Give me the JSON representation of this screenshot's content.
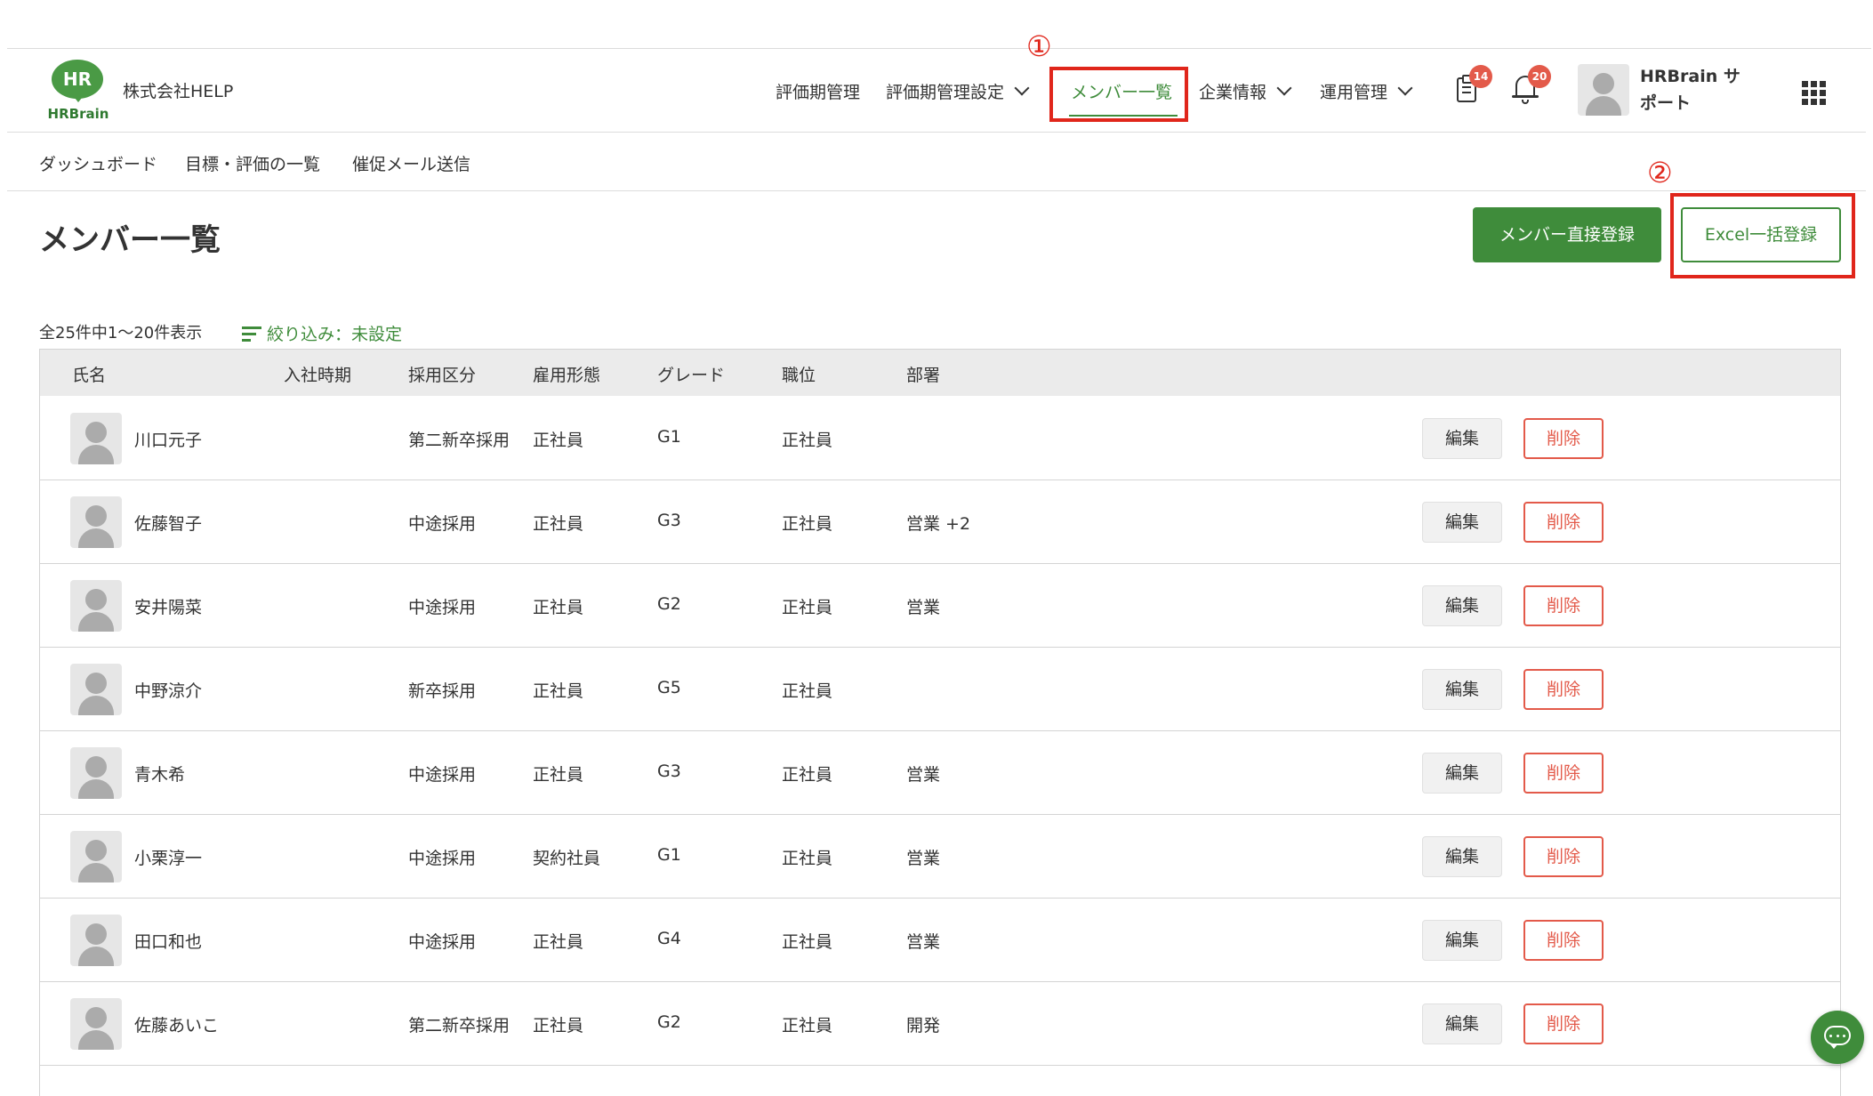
{
  "header": {
    "logo_mark": "HR",
    "logo_word": "HRBrain",
    "company": "株式会社HELP",
    "nav": [
      {
        "label": "評価期管理",
        "has_dropdown": false
      },
      {
        "label": "評価期管理設定",
        "has_dropdown": true
      },
      {
        "label": "メンバー一覧",
        "has_dropdown": false,
        "active": true
      },
      {
        "label": "企業情報",
        "has_dropdown": true
      },
      {
        "label": "運用管理",
        "has_dropdown": true
      }
    ],
    "tasks_badge": "14",
    "notifications_badge": "20",
    "user_name": "HRBrain サポート",
    "icons": {
      "tasks": "clipboard-icon",
      "notifications": "bell-icon",
      "apps": "grid-icon"
    }
  },
  "annotations": {
    "marker_1": "①",
    "marker_2": "②"
  },
  "subnav": [
    "ダッシュボード",
    "目標・評価の一覧",
    "催促メール送信"
  ],
  "page": {
    "title": "メンバー一覧",
    "primary_button": "メンバー直接登録",
    "secondary_button": "Excel一括登録",
    "count_text": "全25件中1〜20件表示",
    "filter_label": "絞り込み：未設定"
  },
  "table": {
    "columns": [
      "氏名",
      "入社時期",
      "採用区分",
      "雇用形態",
      "グレード",
      "職位",
      "部署"
    ],
    "edit_label": "編集",
    "delete_label": "削除",
    "rows": [
      {
        "name": "川口元子",
        "hire_date": "",
        "recruit_type": "第二新卒採用",
        "employment": "正社員",
        "grade": "G1",
        "position": "正社員",
        "department": ""
      },
      {
        "name": "佐藤智子",
        "hire_date": "",
        "recruit_type": "中途採用",
        "employment": "正社員",
        "grade": "G3",
        "position": "正社員",
        "department": "営業  +2"
      },
      {
        "name": "安井陽菜",
        "hire_date": "",
        "recruit_type": "中途採用",
        "employment": "正社員",
        "grade": "G2",
        "position": "正社員",
        "department": "営業"
      },
      {
        "name": "中野涼介",
        "hire_date": "",
        "recruit_type": "新卒採用",
        "employment": "正社員",
        "grade": "G5",
        "position": "正社員",
        "department": ""
      },
      {
        "name": "青木希",
        "hire_date": "",
        "recruit_type": "中途採用",
        "employment": "正社員",
        "grade": "G3",
        "position": "正社員",
        "department": "営業"
      },
      {
        "name": "小栗淳一",
        "hire_date": "",
        "recruit_type": "中途採用",
        "employment": "契約社員",
        "grade": "G1",
        "position": "正社員",
        "department": "営業"
      },
      {
        "name": "田口和也",
        "hire_date": "",
        "recruit_type": "中途採用",
        "employment": "正社員",
        "grade": "G4",
        "position": "正社員",
        "department": "営業"
      },
      {
        "name": "佐藤あいこ",
        "hire_date": "",
        "recruit_type": "第二新卒採用",
        "employment": "正社員",
        "grade": "G2",
        "position": "正社員",
        "department": "開発"
      }
    ]
  },
  "colors": {
    "brand_green": "#3f8c3b",
    "danger_red": "#e35a4a",
    "annotation_red": "#e0261b"
  }
}
